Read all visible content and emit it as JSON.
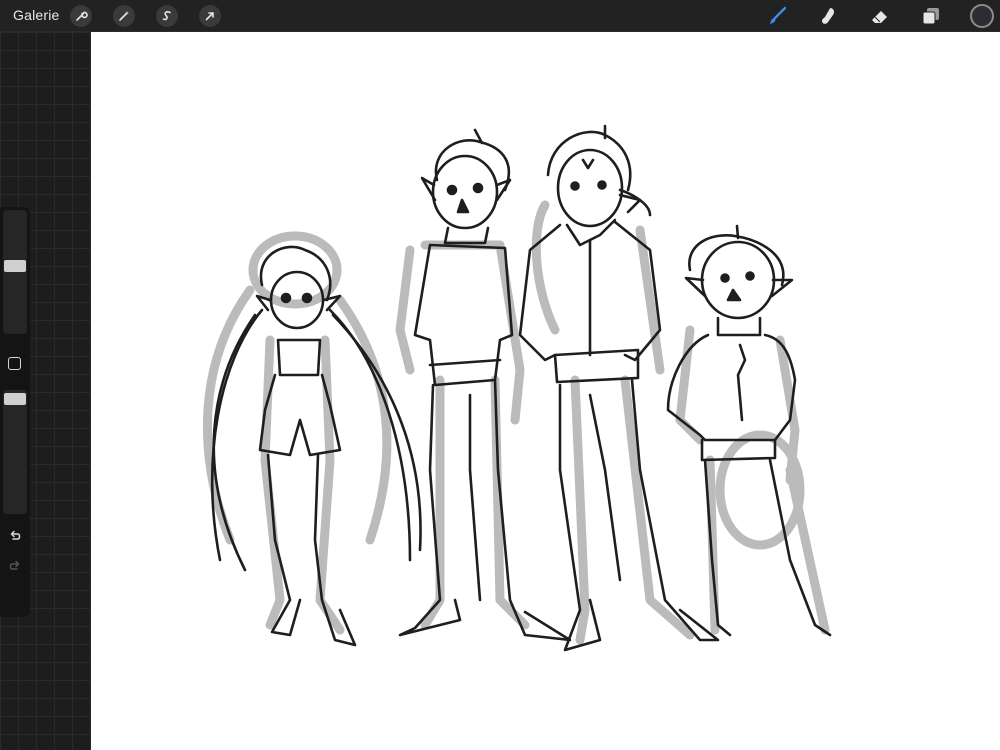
{
  "topbar": {
    "gallery_label": "Galerie",
    "left_tools": [
      {
        "name": "actions",
        "icon": "wrench-icon"
      },
      {
        "name": "adjustments",
        "icon": "magic-wand-icon"
      },
      {
        "name": "selection",
        "icon": "selection-s-icon"
      },
      {
        "name": "transform",
        "icon": "arrow-cursor-icon"
      }
    ],
    "right_tools": [
      {
        "name": "brush",
        "icon": "brush-icon",
        "active": true
      },
      {
        "name": "smudge",
        "icon": "smudge-finger-icon",
        "active": false
      },
      {
        "name": "eraser",
        "icon": "eraser-icon",
        "active": false
      },
      {
        "name": "layers",
        "icon": "layers-icon",
        "active": false
      }
    ],
    "current_color": "#2b2d33"
  },
  "sidebar": {
    "brush_size_level": 0.55,
    "brush_opacity_level": 0.97,
    "undo_icon": "undo-icon",
    "redo_icon": "redo-icon",
    "modify_icon": "square-icon"
  },
  "canvas": {
    "background": "#ffffff",
    "sketch_ink": "#1e1e1e",
    "underlay_gray": "#b4b4b4",
    "accent_blue": "#3d8bf2",
    "figures": [
      "girl-with-long-hair",
      "tall-boy",
      "tall-man-with-jacket",
      "short-boy"
    ]
  }
}
